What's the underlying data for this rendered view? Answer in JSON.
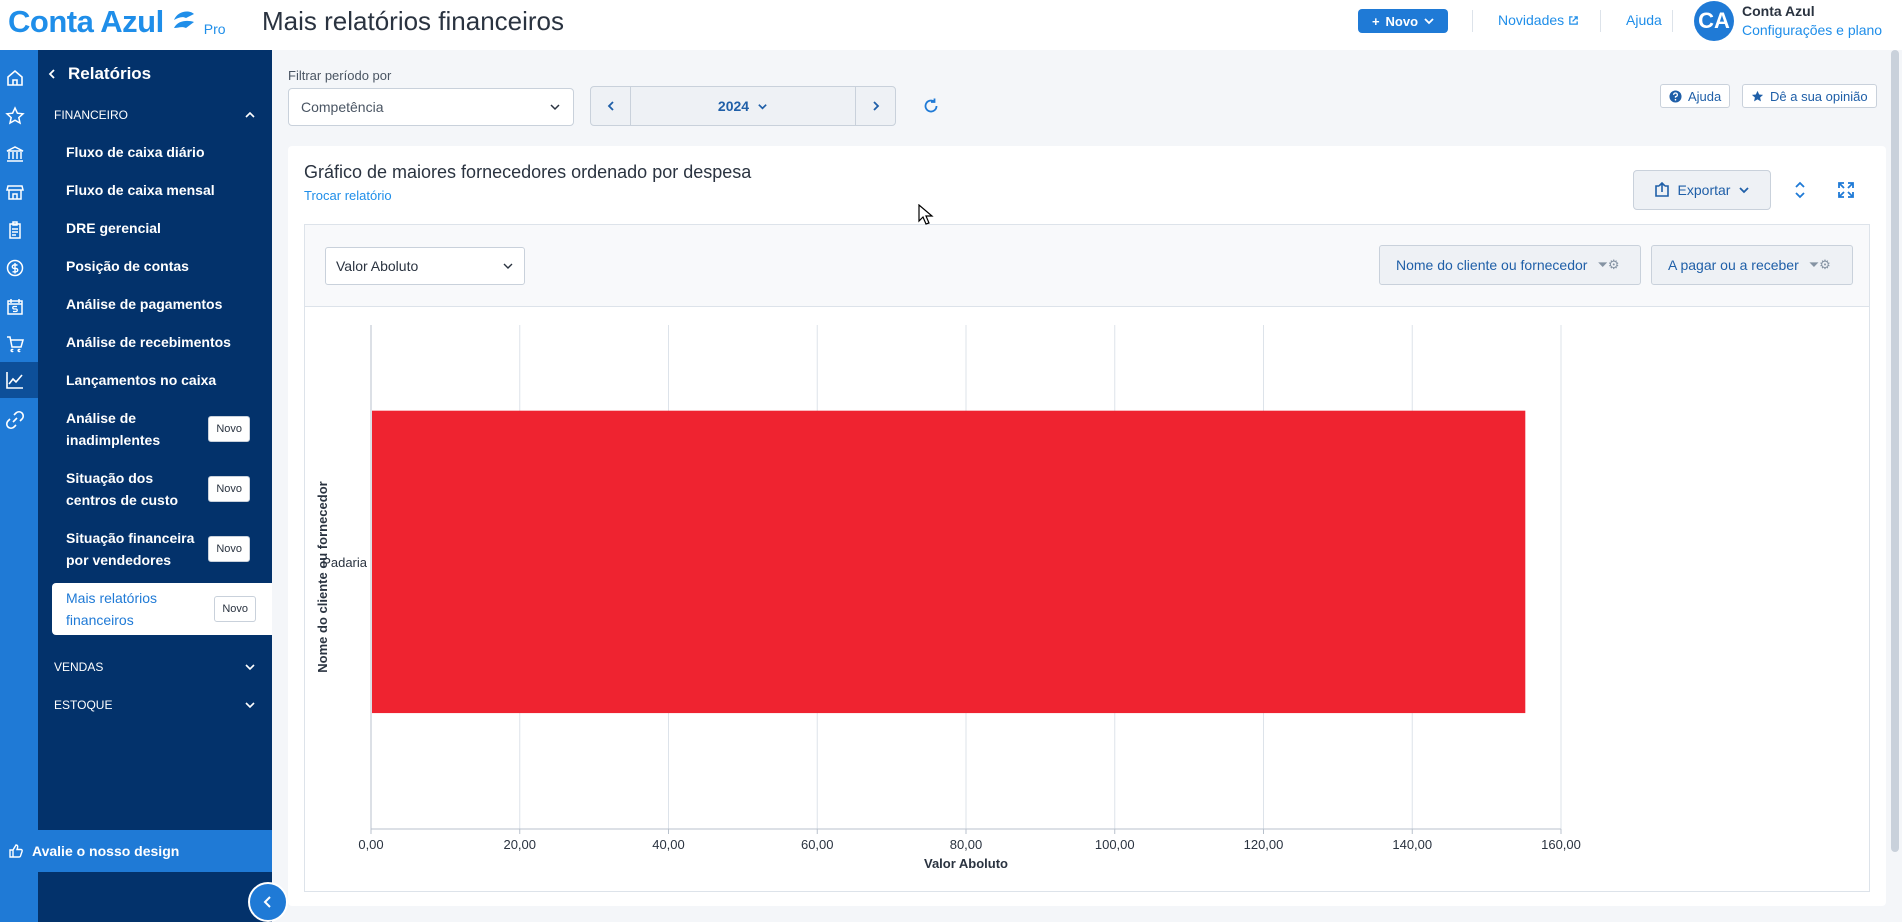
{
  "app": {
    "logo_text": "Conta Azul",
    "logo_badge": "Pro",
    "page_title": "Mais relatórios financeiros",
    "new_button": "Novo",
    "news_link": "Novidades",
    "help_link": "Ajuda",
    "avatar_initials": "CA",
    "account_name": "Conta Azul",
    "account_sub": "Configurações e plano",
    "brand_color": "#1f7ad6",
    "sidebar_color": "#03326b"
  },
  "rail": {
    "icons": [
      "home-icon",
      "star-icon",
      "bank-icon",
      "store-icon",
      "clipboard-icon",
      "dollar-icon",
      "calendar-dollar-icon",
      "cart-icon",
      "chart-line-icon",
      "link-icon"
    ]
  },
  "sidebar": {
    "title": "Relatórios",
    "sections": [
      {
        "label": "FINANCEIRO",
        "expanded": true
      },
      {
        "label": "VENDAS",
        "expanded": false
      },
      {
        "label": "ESTOQUE",
        "expanded": false
      }
    ],
    "items": [
      {
        "label": "Fluxo de caixa diário"
      },
      {
        "label": "Fluxo de caixa mensal"
      },
      {
        "label": "DRE gerencial"
      },
      {
        "label": "Posição de contas"
      },
      {
        "label": "Análise de pagamentos"
      },
      {
        "label": "Análise de recebimentos"
      },
      {
        "label": "Lançamentos no caixa"
      },
      {
        "label": "Análise de inadimplentes",
        "badge": "Novo"
      },
      {
        "label": "Situação dos centros de custo",
        "badge": "Novo"
      },
      {
        "label": "Situação financeira por vendedores",
        "badge": "Novo"
      },
      {
        "label": "Mais relatórios financeiros",
        "badge": "Novo",
        "active": true
      }
    ],
    "footer": "Avalie o nosso design"
  },
  "filters": {
    "label": "Filtrar período por",
    "period_type": "Competência",
    "year": "2024",
    "help_button": "Ajuda",
    "feedback_button": "Dê a sua opinião"
  },
  "report": {
    "title": "Gráfico de maiores fornecedores ordenado por despesa",
    "switch_link": "Trocar relatório",
    "export_button": "Exportar",
    "value_select": "Valor Aboluto",
    "chip_1": "Nome do cliente ou fornecedor",
    "chip_2": "A pagar ou a receber"
  },
  "chart_data": {
    "type": "bar",
    "orientation": "horizontal",
    "categories": [
      "Padaria"
    ],
    "values": [
      155.2
    ],
    "xlabel": "Valor Aboluto",
    "ylabel": "Nome do cliente ou fornecedor",
    "xlim": [
      0,
      160
    ],
    "xticks": [
      "0,00",
      "20,00",
      "40,00",
      "60,00",
      "80,00",
      "100,00",
      "120,00",
      "140,00",
      "160,00"
    ],
    "bar_color": "#ef2330",
    "grid": true
  }
}
